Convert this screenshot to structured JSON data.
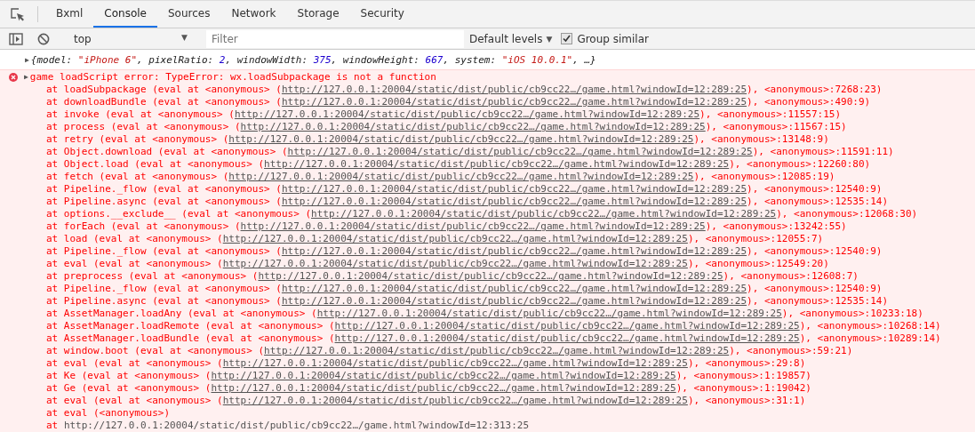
{
  "tabs": [
    {
      "label": "Bxml",
      "selected": false
    },
    {
      "label": "Console",
      "selected": true
    },
    {
      "label": "Sources",
      "selected": false
    },
    {
      "label": "Network",
      "selected": false
    },
    {
      "label": "Storage",
      "selected": false
    },
    {
      "label": "Security",
      "selected": false
    }
  ],
  "toolbar": {
    "context": "top",
    "filter": {
      "placeholder": "Filter"
    },
    "levels": "Default levels",
    "levels_caret": "▼",
    "context_caret": "▼",
    "group_similar": {
      "label": "Group similar",
      "checked": true
    }
  },
  "log_object": {
    "expander": "▶",
    "parts": [
      {
        "kind": "punct",
        "text": "{model: "
      },
      {
        "kind": "string",
        "text": "\"iPhone 6\""
      },
      {
        "kind": "punct",
        "text": ", pixelRatio: "
      },
      {
        "kind": "number",
        "text": "2"
      },
      {
        "kind": "punct",
        "text": ", windowWidth: "
      },
      {
        "kind": "number",
        "text": "375"
      },
      {
        "kind": "punct",
        "text": ", windowHeight: "
      },
      {
        "kind": "number",
        "text": "667"
      },
      {
        "kind": "punct",
        "text": ", system: "
      },
      {
        "kind": "string",
        "text": "\"iOS 10.0.1\""
      },
      {
        "kind": "punct",
        "text": ", …}"
      }
    ]
  },
  "error": {
    "expander": "▶",
    "message": "game loadScript error: TypeError: wx.loadSubpackage is not a function",
    "stack": [
      {
        "kind": "frame",
        "text": "at loadSubpackage (eval at <anonymous> (",
        "url": "http://127.0.0.1:20004/static/dist/public/cb9cc22…/game.html?windowId=12:289:25",
        "suffix": "), <anonymous>:7268:23)"
      },
      {
        "kind": "frame",
        "text": "at downloadBundle (eval at <anonymous> (",
        "url": "http://127.0.0.1:20004/static/dist/public/cb9cc22…/game.html?windowId=12:289:25",
        "suffix": "), <anonymous>:490:9)"
      },
      {
        "kind": "frame",
        "text": "at invoke (eval at <anonymous> (",
        "url": "http://127.0.0.1:20004/static/dist/public/cb9cc22…/game.html?windowId=12:289:25",
        "suffix": "), <anonymous>:11557:15)"
      },
      {
        "kind": "frame",
        "text": "at process (eval at <anonymous> (",
        "url": "http://127.0.0.1:20004/static/dist/public/cb9cc22…/game.html?windowId=12:289:25",
        "suffix": "), <anonymous>:11567:15)"
      },
      {
        "kind": "frame",
        "text": "at retry (eval at <anonymous> (",
        "url": "http://127.0.0.1:20004/static/dist/public/cb9cc22…/game.html?windowId=12:289:25",
        "suffix": "), <anonymous>:13148:9)"
      },
      {
        "kind": "frame",
        "text": "at Object.download (eval at <anonymous> (",
        "url": "http://127.0.0.1:20004/static/dist/public/cb9cc22…/game.html?windowId=12:289:25",
        "suffix": "), <anonymous>:11591:11)"
      },
      {
        "kind": "frame",
        "text": "at Object.load (eval at <anonymous> (",
        "url": "http://127.0.0.1:20004/static/dist/public/cb9cc22…/game.html?windowId=12:289:25",
        "suffix": "), <anonymous>:12260:80)"
      },
      {
        "kind": "frame",
        "text": "at fetch (eval at <anonymous> (",
        "url": "http://127.0.0.1:20004/static/dist/public/cb9cc22…/game.html?windowId=12:289:25",
        "suffix": "), <anonymous>:12085:19)"
      },
      {
        "kind": "frame",
        "text": "at Pipeline._flow (eval at <anonymous> (",
        "url": "http://127.0.0.1:20004/static/dist/public/cb9cc22…/game.html?windowId=12:289:25",
        "suffix": "), <anonymous>:12540:9)"
      },
      {
        "kind": "frame",
        "text": "at Pipeline.async (eval at <anonymous> (",
        "url": "http://127.0.0.1:20004/static/dist/public/cb9cc22…/game.html?windowId=12:289:25",
        "suffix": "), <anonymous>:12535:14)"
      },
      {
        "kind": "frame",
        "text": "at options.__exclude__ (eval at <anonymous> (",
        "url": "http://127.0.0.1:20004/static/dist/public/cb9cc22…/game.html?windowId=12:289:25",
        "suffix": "), <anonymous>:12068:30)"
      },
      {
        "kind": "frame",
        "text": "at forEach (eval at <anonymous> (",
        "url": "http://127.0.0.1:20004/static/dist/public/cb9cc22…/game.html?windowId=12:289:25",
        "suffix": "), <anonymous>:13242:55)"
      },
      {
        "kind": "frame",
        "text": "at load (eval at <anonymous> (",
        "url": "http://127.0.0.1:20004/static/dist/public/cb9cc22…/game.html?windowId=12:289:25",
        "suffix": "), <anonymous>:12055:7)"
      },
      {
        "kind": "frame",
        "text": "at Pipeline._flow (eval at <anonymous> (",
        "url": "http://127.0.0.1:20004/static/dist/public/cb9cc22…/game.html?windowId=12:289:25",
        "suffix": "), <anonymous>:12540:9)"
      },
      {
        "kind": "frame",
        "text": "at eval (eval at <anonymous> (",
        "url": "http://127.0.0.1:20004/static/dist/public/cb9cc22…/game.html?windowId=12:289:25",
        "suffix": "), <anonymous>:12549:20)"
      },
      {
        "kind": "frame",
        "text": "at preprocess (eval at <anonymous> (",
        "url": "http://127.0.0.1:20004/static/dist/public/cb9cc22…/game.html?windowId=12:289:25",
        "suffix": "), <anonymous>:12608:7)"
      },
      {
        "kind": "frame",
        "text": "at Pipeline._flow (eval at <anonymous> (",
        "url": "http://127.0.0.1:20004/static/dist/public/cb9cc22…/game.html?windowId=12:289:25",
        "suffix": "), <anonymous>:12540:9)"
      },
      {
        "kind": "frame",
        "text": "at Pipeline.async (eval at <anonymous> (",
        "url": "http://127.0.0.1:20004/static/dist/public/cb9cc22…/game.html?windowId=12:289:25",
        "suffix": "), <anonymous>:12535:14)"
      },
      {
        "kind": "frame",
        "text": "at AssetManager.loadAny (eval at <anonymous> (",
        "url": "http://127.0.0.1:20004/static/dist/public/cb9cc22…/game.html?windowId=12:289:25",
        "suffix": "), <anonymous>:10233:18)"
      },
      {
        "kind": "frame",
        "text": "at AssetManager.loadRemote (eval at <anonymous> (",
        "url": "http://127.0.0.1:20004/static/dist/public/cb9cc22…/game.html?windowId=12:289:25",
        "suffix": "), <anonymous>:10268:14)"
      },
      {
        "kind": "frame",
        "text": "at AssetManager.loadBundle (eval at <anonymous> (",
        "url": "http://127.0.0.1:20004/static/dist/public/cb9cc22…/game.html?windowId=12:289:25",
        "suffix": "), <anonymous>:10289:14)"
      },
      {
        "kind": "frame",
        "text": "at window.boot (eval at <anonymous> (",
        "url": "http://127.0.0.1:20004/static/dist/public/cb9cc22…/game.html?windowId=12:289:25",
        "suffix": "), <anonymous>:59:21)"
      },
      {
        "kind": "frame",
        "text": "at eval (eval at <anonymous> (",
        "url": "http://127.0.0.1:20004/static/dist/public/cb9cc22…/game.html?windowId=12:289:25",
        "suffix": "), <anonymous>:29:8)"
      },
      {
        "kind": "frame",
        "text": "at Ke (eval at <anonymous> (",
        "url": "http://127.0.0.1:20004/static/dist/public/cb9cc22…/game.html?windowId=12:289:25",
        "suffix": "), <anonymous>:1:19857)"
      },
      {
        "kind": "frame",
        "text": "at Ge (eval at <anonymous> (",
        "url": "http://127.0.0.1:20004/static/dist/public/cb9cc22…/game.html?windowId=12:289:25",
        "suffix": "), <anonymous>:1:19042)"
      },
      {
        "kind": "frame",
        "text": "at eval (eval at <anonymous> (",
        "url": "http://127.0.0.1:20004/static/dist/public/cb9cc22…/game.html?windowId=12:289:25",
        "suffix": "), <anonymous>:31:1)"
      },
      {
        "kind": "plain",
        "text": "at eval (<anonymous>)"
      },
      {
        "kind": "location",
        "text": "at ",
        "url": "http://127.0.0.1:20004/static/dist/public/cb9cc22…/game.html?windowId=12:313:25"
      }
    ]
  }
}
